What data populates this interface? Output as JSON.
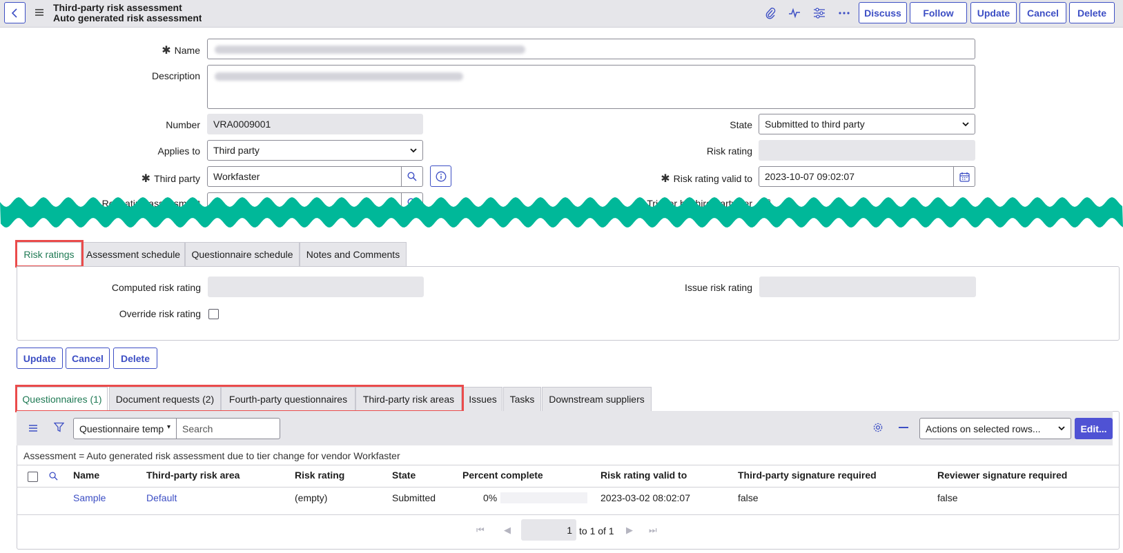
{
  "header": {
    "title": "Third-party risk assessment",
    "subtitle": "Auto generated risk assessment due to tier change for vendor Workfaster",
    "buttons": {
      "discuss": "Discuss",
      "follow": "Follow",
      "update": "Update",
      "cancel": "Cancel",
      "delete": "Delete"
    },
    "icons": [
      "paperclip-icon",
      "activity-icon",
      "settings-sliders-icon",
      "more-icon"
    ]
  },
  "form": {
    "name_label": "Name",
    "description_label": "Description",
    "number_label": "Number",
    "number_value": "VRA0009001",
    "applies_to_label": "Applies to",
    "applies_to_value": "Third party",
    "third_party_label": "Third party",
    "third_party_value": "Workfaster",
    "repeating_label": "Repeating assessment",
    "state_label": "State",
    "state_value": "Submitted to third party",
    "risk_rating_label": "Risk rating",
    "risk_valid_label": "Risk rating valid to",
    "risk_valid_value": "2023-10-07 09:02:07",
    "trigger_label": "Trigger by third-party tier"
  },
  "section_tabs": [
    {
      "label": "Risk ratings"
    },
    {
      "label": "Assessment schedule"
    },
    {
      "label": "Questionnaire schedule"
    },
    {
      "label": "Notes and Comments"
    }
  ],
  "risk_panel": {
    "computed_label": "Computed risk rating",
    "override_label": "Override risk rating",
    "issue_label": "Issue risk rating"
  },
  "actions": {
    "update": "Update",
    "cancel": "Cancel",
    "delete": "Delete"
  },
  "related_tabs": [
    {
      "label": "Questionnaires (1)"
    },
    {
      "label": "Document requests (2)"
    },
    {
      "label": "Fourth-party questionnaires"
    },
    {
      "label": "Third-party risk areas"
    },
    {
      "label": "Issues"
    },
    {
      "label": "Tasks"
    },
    {
      "label": "Downstream suppliers"
    }
  ],
  "list": {
    "filter_field": "Questionnaire temp",
    "search_placeholder": "Search",
    "actions_select": "Actions on selected rows...",
    "edit_button": "Edit...",
    "breadcrumb": "Assessment = Auto generated risk assessment due to tier change for vendor Workfaster",
    "columns": [
      "Name",
      "Third-party risk area",
      "Risk rating",
      "State",
      "Percent complete",
      "Risk rating valid to",
      "Third-party signature required",
      "Reviewer signature required"
    ],
    "rows": [
      {
        "name": "Sample",
        "risk_area": "Default",
        "risk_rating": "(empty)",
        "state": "Submitted",
        "percent": "0%",
        "percent_value": 0,
        "valid_to": "2023-03-02 08:02:07",
        "tp_signature": "false",
        "reviewer_signature": "false"
      }
    ],
    "pagination": {
      "page": "1",
      "of_text": "to 1 of 1"
    }
  },
  "colors": {
    "accent": "#3c4ec4",
    "active_tab_text": "#1f7a54",
    "highlight": "#ea4b4b",
    "wave": "#00b899",
    "edit_button": "#4f52d4"
  }
}
